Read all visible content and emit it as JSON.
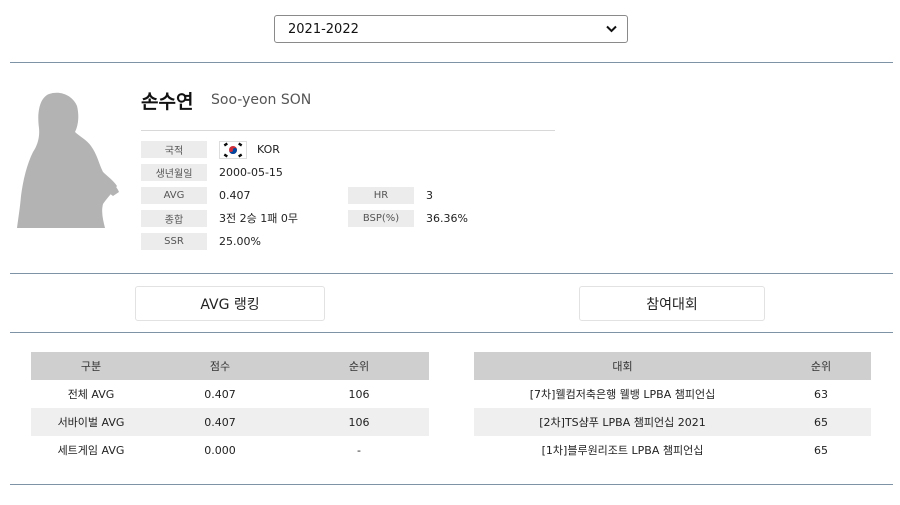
{
  "season_select": {
    "value": "2021-2022"
  },
  "player": {
    "name_ko": "손수연",
    "name_en": "Soo-yeon SON",
    "nationality_label": "국적",
    "nationality": "KOR",
    "birthdate_label": "생년월일",
    "birthdate": "2000-05-15",
    "avg_label": "AVG",
    "avg": "0.407",
    "hr_label": "HR",
    "hr": "3",
    "record_label": "종합",
    "record": "3전 2승 1패 0무",
    "bsp_label": "BSP(%)",
    "bsp": "36.36%",
    "ssr_label": "SSR",
    "ssr": "25.00%"
  },
  "tabs": {
    "avg_ranking": "AVG 랭킹",
    "tournaments": "참여대회"
  },
  "avg_table": {
    "headers": [
      "구분",
      "점수",
      "순위"
    ],
    "rows": [
      [
        "전체 AVG",
        "0.407",
        "106"
      ],
      [
        "서바이벌 AVG",
        "0.407",
        "106"
      ],
      [
        "세트게임 AVG",
        "0.000",
        "-"
      ]
    ]
  },
  "tournament_table": {
    "headers": [
      "대회",
      "순위"
    ],
    "rows": [
      [
        "[7차]웰컴저축은행 웰뱅 LPBA 챔피언십",
        "63"
      ],
      [
        "[2차]TS샴푸 LPBA 챔피언십 2021",
        "65"
      ],
      [
        "[1차]블루원리조트 LPBA 챔피언십",
        "65"
      ]
    ]
  }
}
